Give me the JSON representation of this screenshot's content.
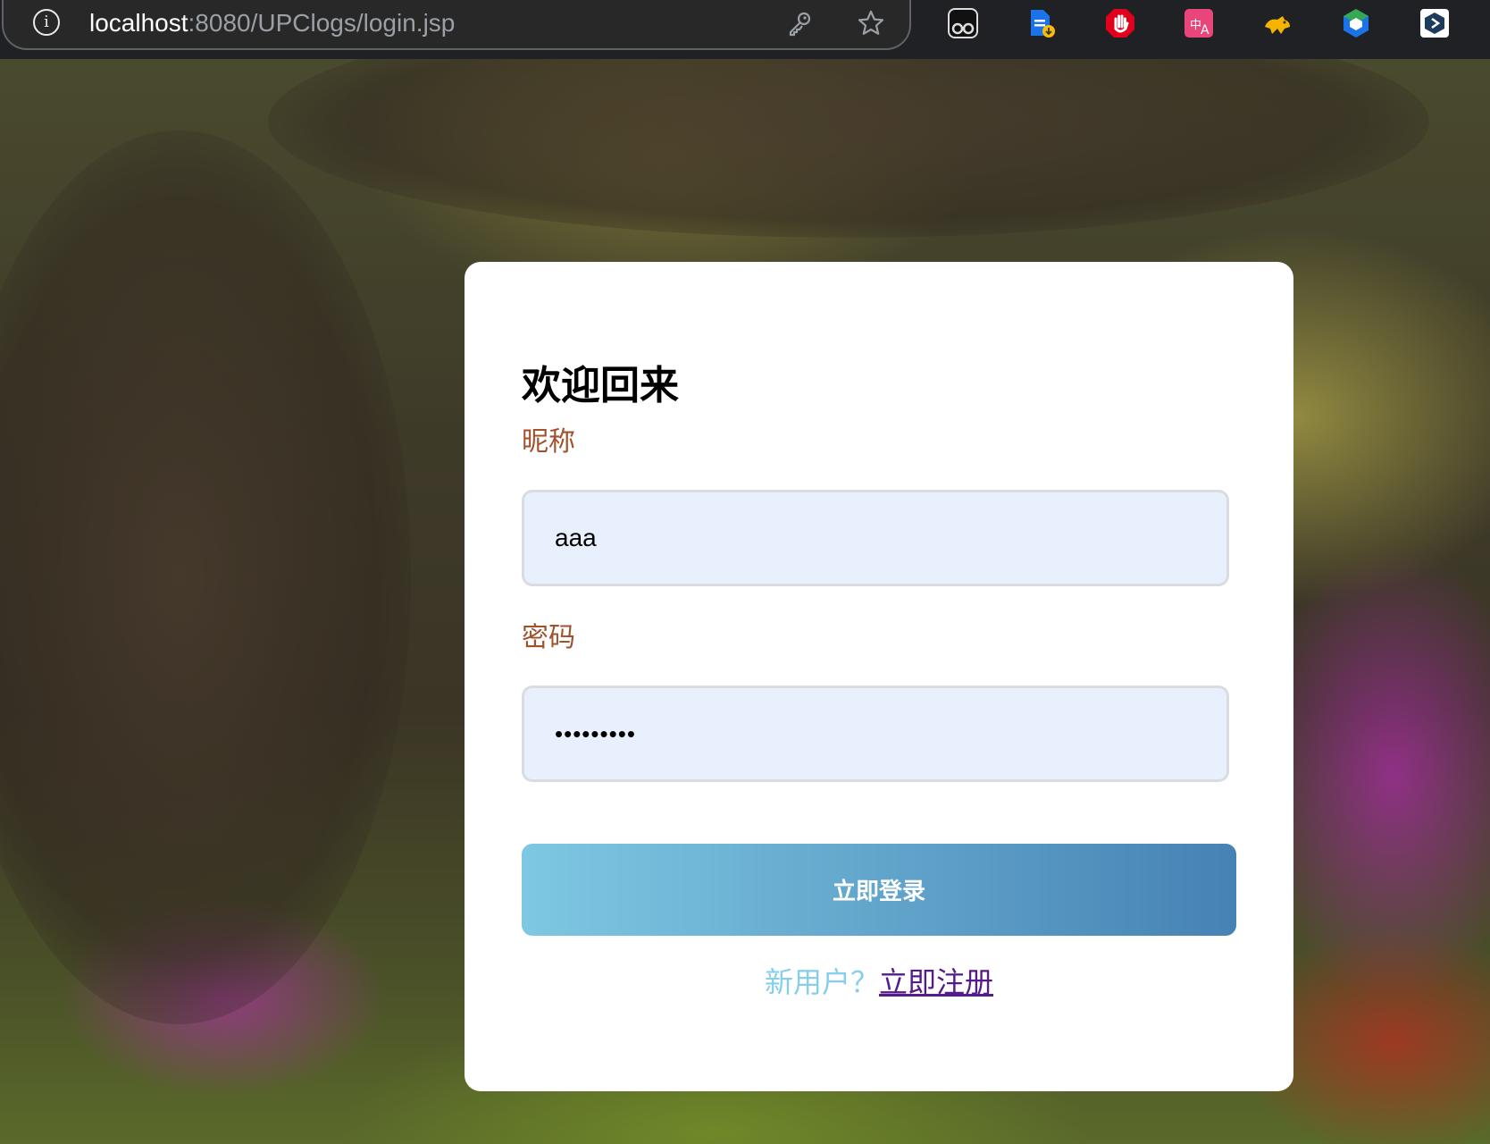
{
  "browser": {
    "url_host": "localhost",
    "url_rest": ":8080/UPClogs/login.jsp",
    "icons": [
      "info-icon",
      "key-icon",
      "star-icon"
    ],
    "extensions": [
      "tampermonkey-icon",
      "document-download-icon",
      "adblock-icon",
      "translate-icon",
      "cat-icon",
      "hexagon-icon",
      "cube-icon"
    ]
  },
  "login": {
    "title": "欢迎回来",
    "nickname_label": "昵称",
    "nickname_value": "aaa",
    "password_label": "密码",
    "password_value": "•••••••••",
    "submit_label": "立即登录",
    "register_prompt": "新用户？",
    "register_link": "立即注册"
  },
  "colors": {
    "label": "#a0522d",
    "input_bg": "#e8f0fe",
    "button_gradient_start": "#7ec8e3",
    "button_gradient_end": "#4682b4",
    "register_prompt": "#87ceeb",
    "register_link": "#551a8b"
  }
}
